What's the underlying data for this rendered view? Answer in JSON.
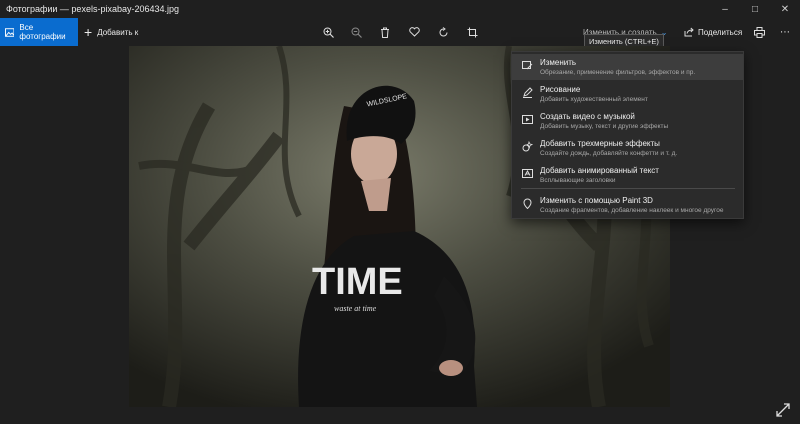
{
  "window": {
    "title": "Фотографии — pexels-pixabay-206434.jpg",
    "controls": [
      "minimize-icon",
      "maximize-icon",
      "close-icon"
    ]
  },
  "toolbar": {
    "all_photos_label": "Все фотографии",
    "add_label": "Добавить к",
    "edit_label": "Изменить и создать",
    "share_label": "Поделиться",
    "tools": [
      "zoom-in-icon",
      "zoom-out-icon",
      "delete-icon",
      "favorite-icon",
      "rotate-icon",
      "crop-icon",
      "print-icon",
      "more-icon"
    ]
  },
  "tooltip": {
    "text": "Изменить (CTRL+E)"
  },
  "menu": {
    "items": [
      {
        "title": "Изменить",
        "subtitle": "Обрезание, применение фильтров, эффектов и пр.",
        "icon": "edit-image-icon"
      },
      {
        "title": "Рисование",
        "subtitle": "Добавить художественный элемент",
        "icon": "pen-icon"
      },
      {
        "title": "Создать видео с музыкой",
        "subtitle": "Добавить музыку, текст и другие эффекты",
        "icon": "video-icon"
      },
      {
        "title": "Добавить трехмерные эффекты",
        "subtitle": "Создайте дождь, добавляйте конфетти и т. д.",
        "icon": "3d-effects-icon"
      },
      {
        "title": "Добавить анимированный текст",
        "subtitle": "Всплывающие заголовки",
        "icon": "animated-text-icon"
      },
      {
        "title": "Изменить с помощью Paint 3D",
        "subtitle": "Создание фрагментов, добавление наклеек и многое другое",
        "icon": "paint3d-icon"
      }
    ]
  },
  "photo": {
    "hat_text": "WILDSLOPE",
    "shirt_text": "TIME",
    "shirt_subtext": "waste at time"
  },
  "colors": {
    "accent": "#0a6ccf",
    "background": "#1f1f1f",
    "menu_bg": "#2b2b2b"
  }
}
